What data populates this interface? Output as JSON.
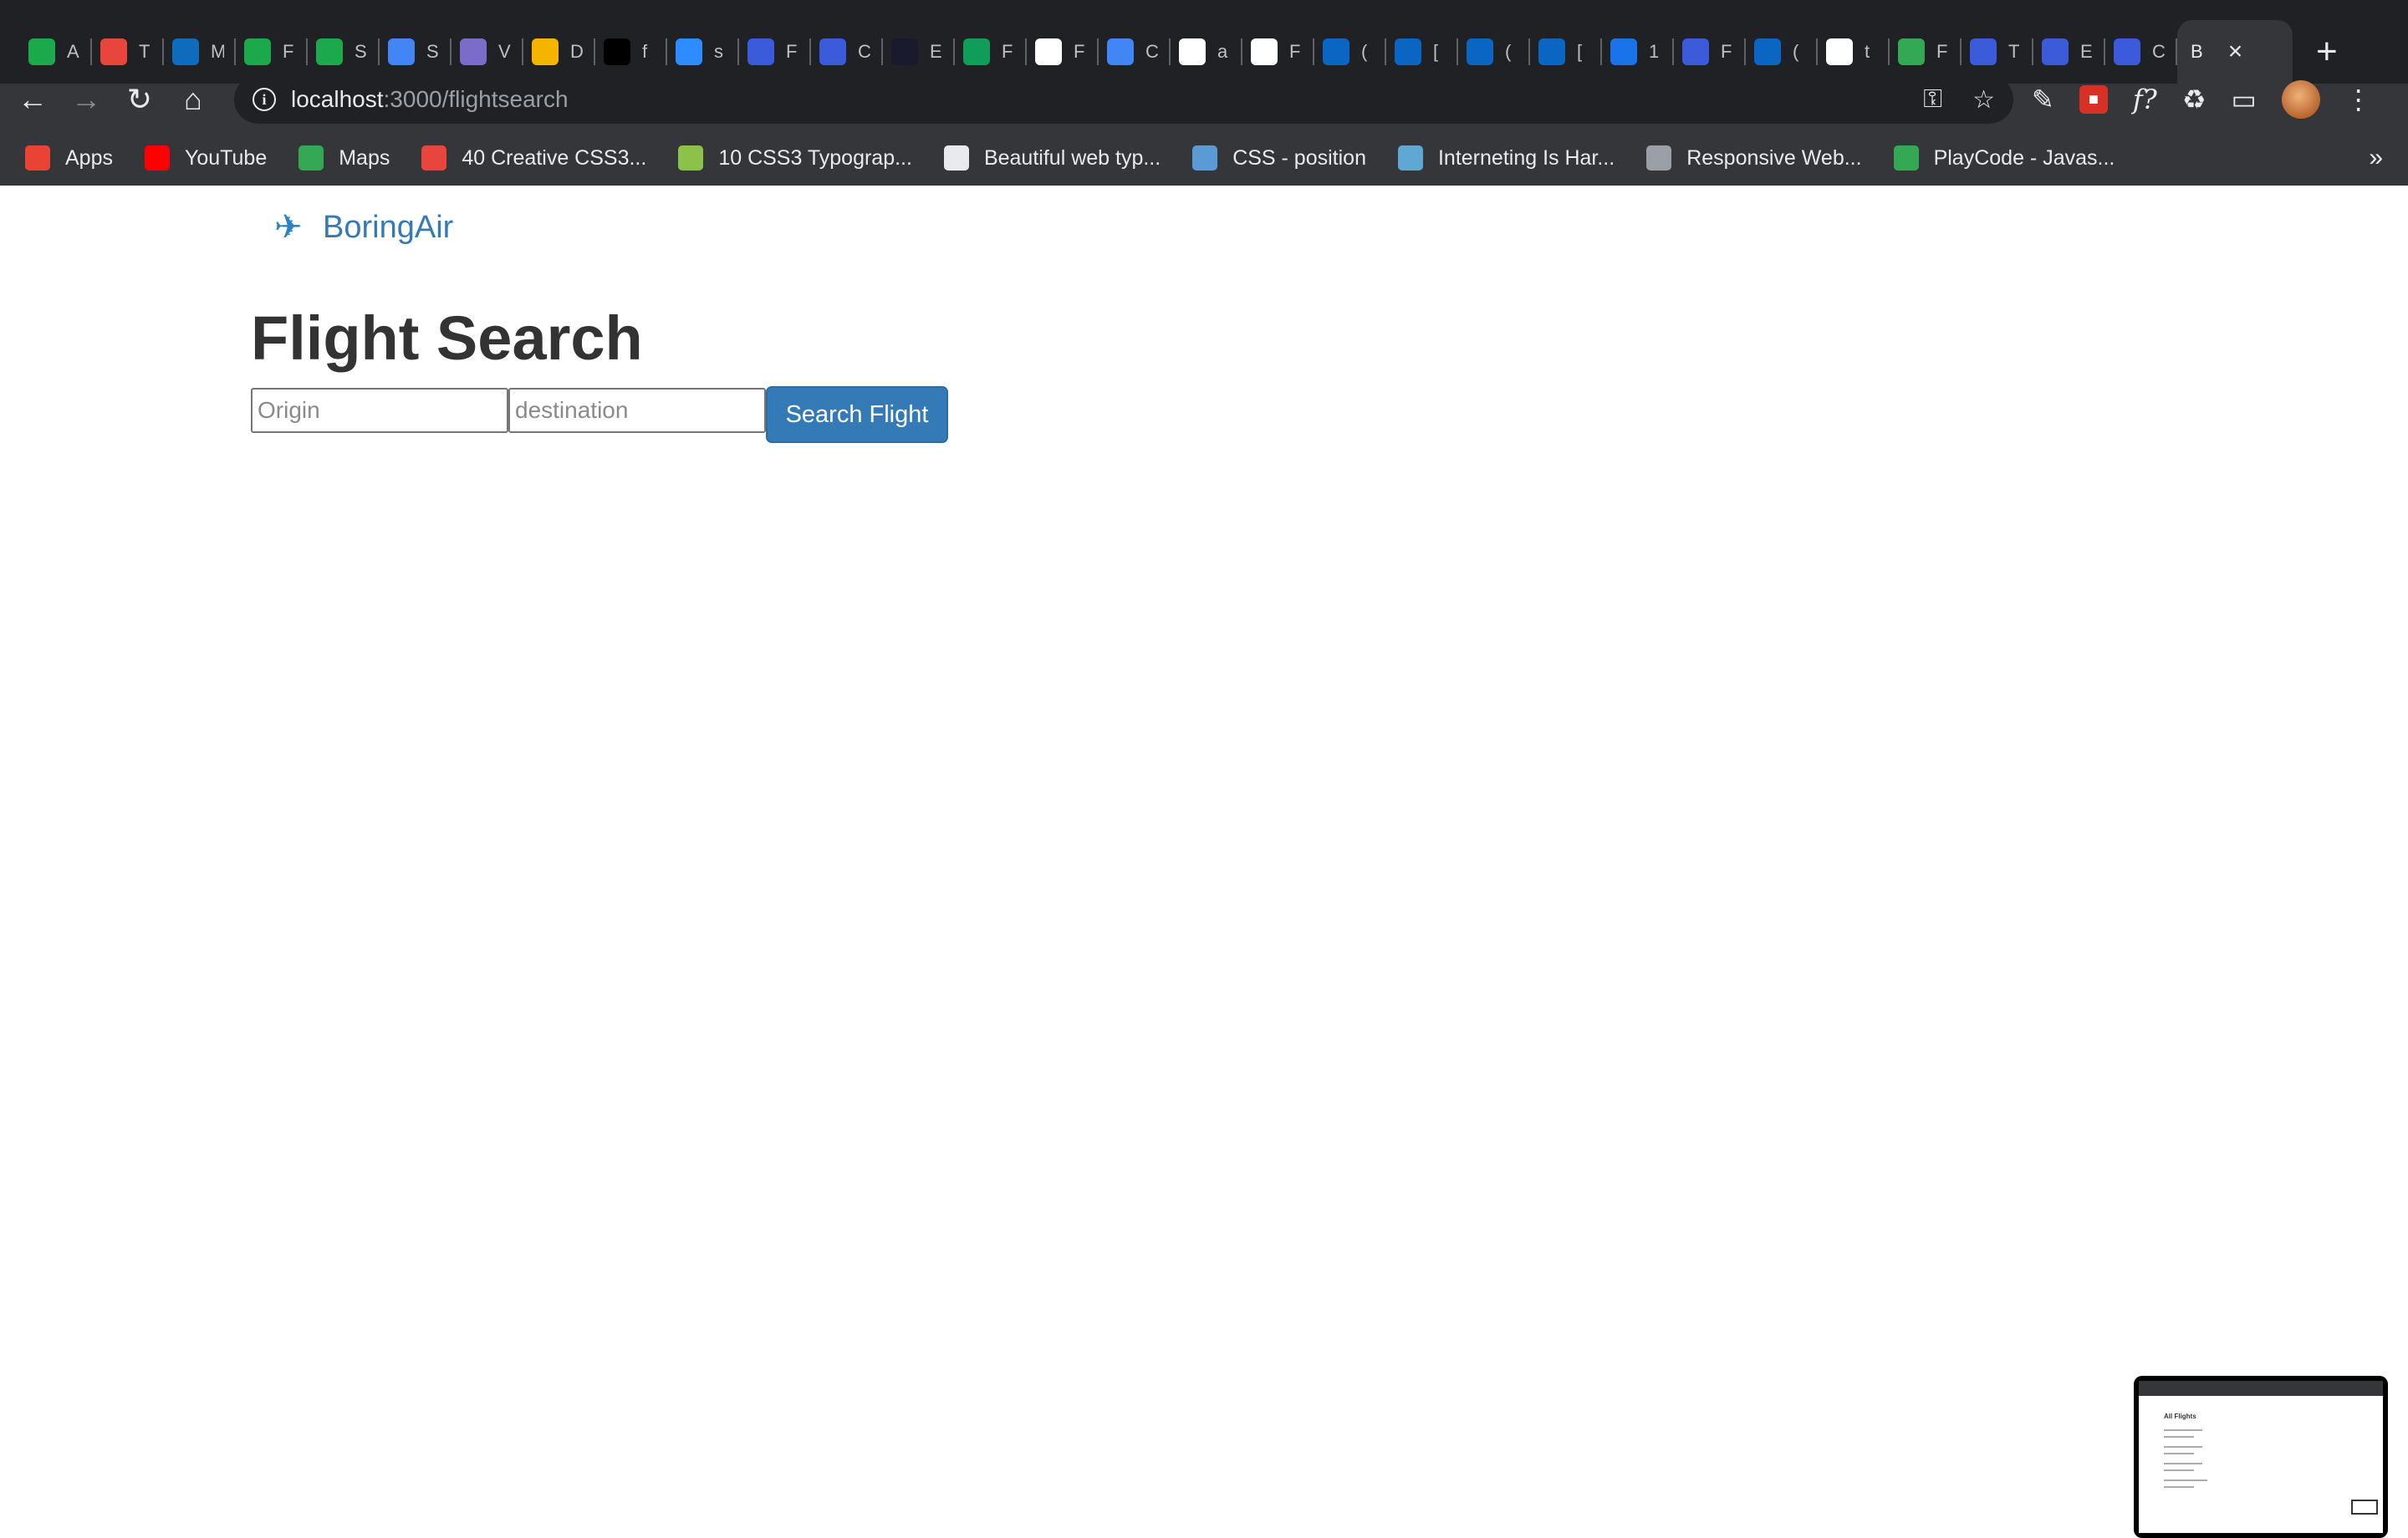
{
  "browser": {
    "tabs": [
      {
        "icon": "hackerrank-icon",
        "letter": "A",
        "color": "#1ba94c"
      },
      {
        "icon": "t-logo-icon",
        "letter": "T",
        "color": "#e8453c"
      },
      {
        "icon": "outlook-icon",
        "letter": "M",
        "color": "#0f6cbd"
      },
      {
        "icon": "hackerrank-icon",
        "letter": "F",
        "color": "#1ba94c"
      },
      {
        "icon": "hackerrank-icon",
        "letter": "S",
        "color": "#1ba94c"
      },
      {
        "icon": "google-docs-icon",
        "letter": "S",
        "color": "#4285f4"
      },
      {
        "icon": "image-icon",
        "letter": "V",
        "color": "#7b6cc9"
      },
      {
        "icon": "emoji-icon",
        "letter": "D",
        "color": "#f4b400"
      },
      {
        "icon": "bird-icon",
        "letter": "f",
        "color": "#000000"
      },
      {
        "icon": "zoom-icon",
        "letter": "s",
        "color": "#2d8cff"
      },
      {
        "icon": "c-logo-icon",
        "letter": "F",
        "color": "#3b5bdb"
      },
      {
        "icon": "c-logo-icon",
        "letter": "C",
        "color": "#3b5bdb"
      },
      {
        "icon": "b-logo-icon",
        "letter": "E",
        "color": "#1a1a2e"
      },
      {
        "icon": "google-sheets-icon",
        "letter": "F",
        "color": "#0f9d58"
      },
      {
        "icon": "github-icon",
        "letter": "F",
        "color": "#ffffff"
      },
      {
        "icon": "calendar-icon",
        "letter": "C",
        "color": "#4285f4"
      },
      {
        "icon": "google-icon",
        "letter": "a",
        "color": "#ffffff"
      },
      {
        "icon": "github-icon",
        "letter": "F",
        "color": "#ffffff"
      },
      {
        "icon": "linkedin-icon",
        "letter": "(",
        "color": "#0a66c2"
      },
      {
        "icon": "linkedin-icon",
        "letter": "[",
        "color": "#0a66c2"
      },
      {
        "icon": "linkedin-icon",
        "letter": "(",
        "color": "#0a66c2"
      },
      {
        "icon": "linkedin-icon",
        "letter": "[",
        "color": "#0a66c2"
      },
      {
        "icon": "a-logo-icon",
        "letter": "1",
        "color": "#1a73e8"
      },
      {
        "icon": "c-logo-icon",
        "letter": "F",
        "color": "#3b5bdb"
      },
      {
        "icon": "linkedin-icon",
        "letter": "(",
        "color": "#0a66c2"
      },
      {
        "icon": "github-icon",
        "letter": "t",
        "color": "#ffffff"
      },
      {
        "icon": "playcode-icon",
        "letter": "F",
        "color": "#34a853"
      },
      {
        "icon": "c-logo-icon",
        "letter": "T",
        "color": "#3b5bdb"
      },
      {
        "icon": "c-logo-icon",
        "letter": "E",
        "color": "#3b5bdb"
      },
      {
        "icon": "c-logo-icon",
        "letter": "C",
        "color": "#3b5bdb"
      }
    ],
    "active_tab": {
      "letter": "B"
    },
    "new_tab_label": "+",
    "address": {
      "host": "localhost",
      "path": ":3000/flightsearch"
    },
    "bookmarks": [
      {
        "label": "Apps",
        "icon": "apps-grid-icon",
        "color": "#ea4335"
      },
      {
        "label": "YouTube",
        "icon": "youtube-icon",
        "color": "#ff0000"
      },
      {
        "label": "Maps",
        "icon": "maps-pin-icon",
        "color": "#34a853"
      },
      {
        "label": "40 Creative CSS3...",
        "icon": "wd-logo-icon",
        "color": "#e8453c"
      },
      {
        "label": "10 CSS3 Typograp...",
        "icon": "leaf-icon",
        "color": "#8bc34a"
      },
      {
        "label": "Beautiful web typ...",
        "icon": "globe-icon",
        "color": "#e8eaed"
      },
      {
        "label": "CSS - position",
        "icon": "css-logo-icon",
        "color": "#5b9bd5"
      },
      {
        "label": "Interneting Is Har...",
        "icon": "interneting-icon",
        "color": "#5fa8d3"
      },
      {
        "label": "Responsive Web...",
        "icon": "code-brackets-icon",
        "color": "#9aa0a6"
      },
      {
        "label": "PlayCode - Javas...",
        "icon": "playcode-icon",
        "color": "#34a853"
      }
    ],
    "bookmarks_more": "»"
  },
  "page": {
    "brand": "BoringAir",
    "brand_icon": "airplane-icon",
    "title": "Flight Search",
    "origin_placeholder": "Origin",
    "destination_placeholder": "destination",
    "search_button": "Search Flight"
  },
  "thumbnail": {
    "title": "All Flights"
  },
  "colors": {
    "brand": "#337ab7",
    "button": "#337ab7",
    "chrome_dark": "#202124",
    "chrome_toolbar": "#35363a"
  }
}
